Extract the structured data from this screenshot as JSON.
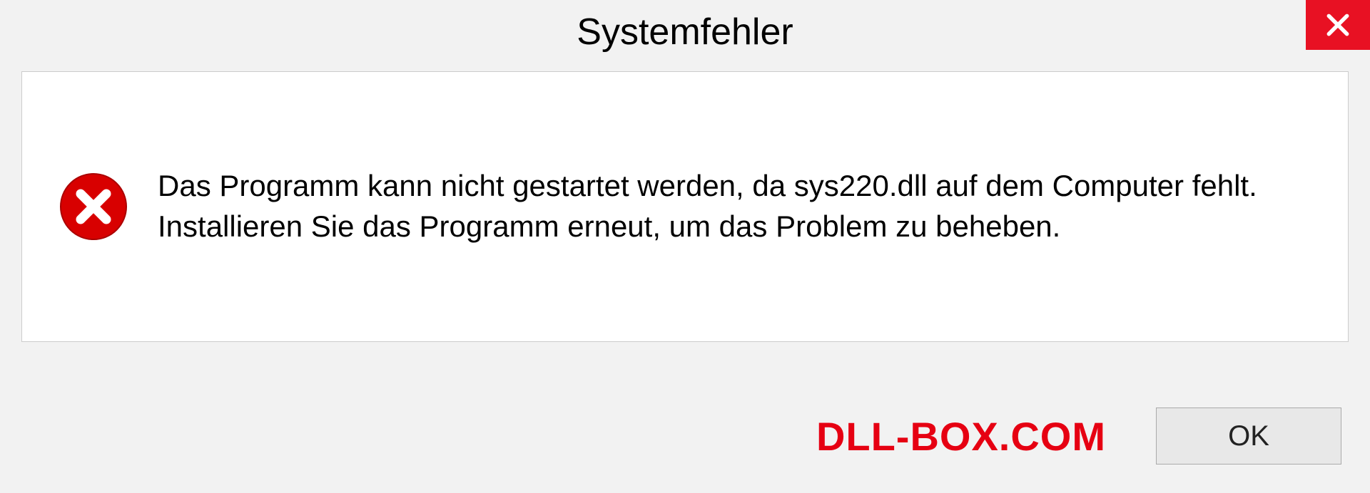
{
  "dialog": {
    "title": "Systemfehler",
    "message": "Das Programm kann nicht gestartet werden, da sys220.dll auf dem Computer fehlt. Installieren Sie das Programm erneut, um das Problem zu beheben.",
    "ok_label": "OK"
  },
  "watermark": "DLL-BOX.COM",
  "colors": {
    "close_bg": "#e81123",
    "error_red": "#d80000",
    "watermark_red": "#e60012"
  }
}
